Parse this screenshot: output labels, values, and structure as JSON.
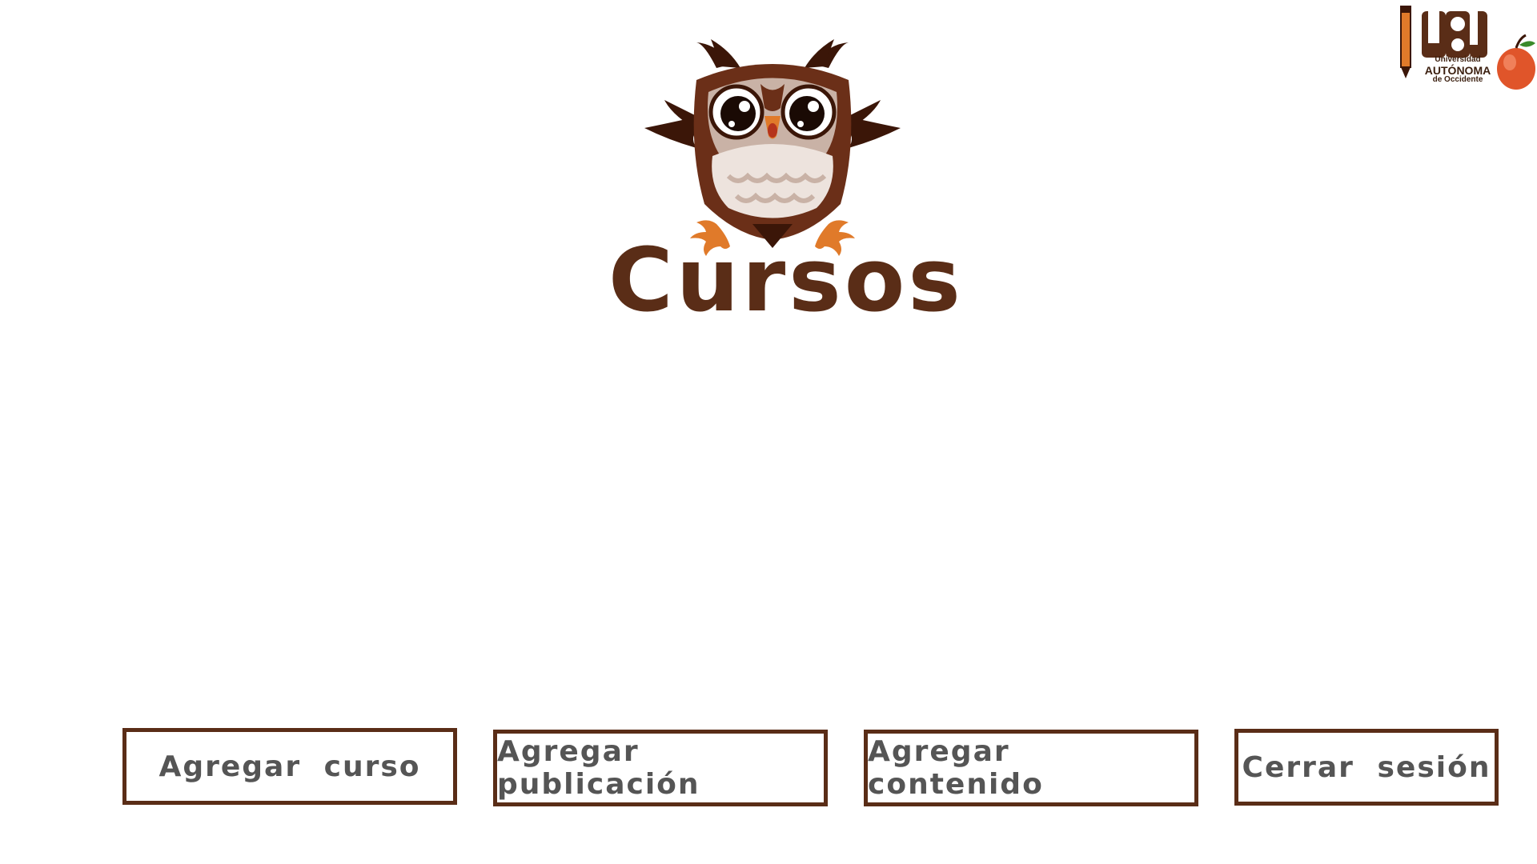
{
  "header": {
    "title": "Cursos",
    "mascot_icon": "owl-icon"
  },
  "logo": {
    "line1": "Universidad",
    "line2": "AUTÓNOMA",
    "line3": "de Occidente",
    "icon": "university-logo-icon"
  },
  "actions": {
    "add_course": "Agregar curso",
    "add_publication": "Agregar publicación",
    "add_content": "Agregar contenido",
    "logout": "Cerrar sesión"
  },
  "colors": {
    "brand_brown": "#5a2d17",
    "button_text": "#555555",
    "background": "#ffffff",
    "accent_orange": "#e07a2a"
  }
}
